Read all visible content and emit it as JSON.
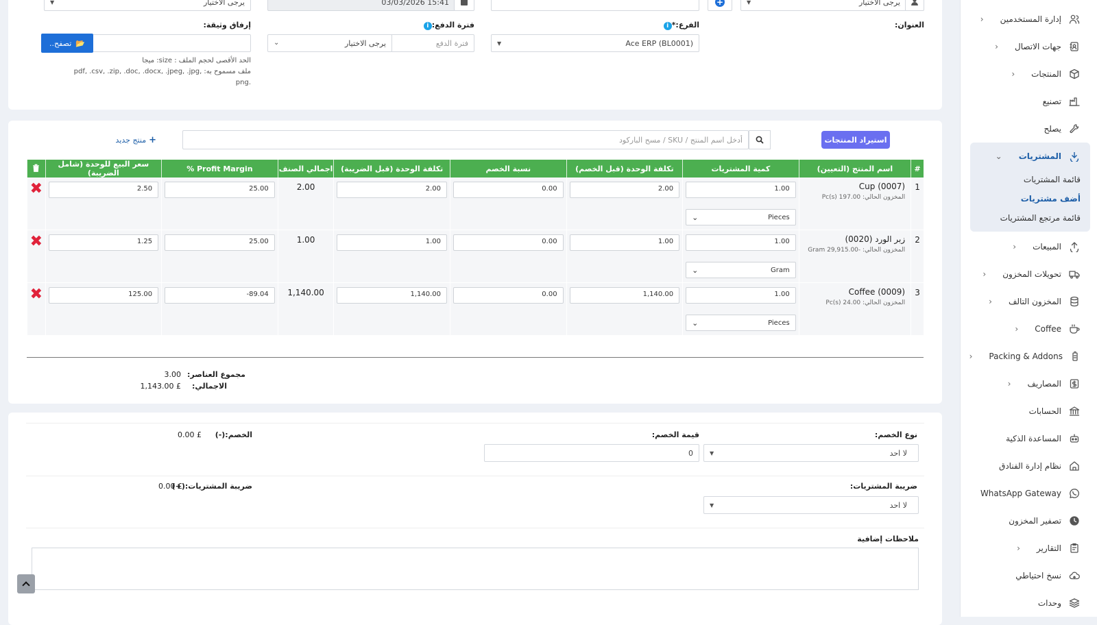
{
  "sidebar": {
    "items": [
      {
        "label": "إدارة المستخدمين",
        "icon": "users-icon",
        "chev": true
      },
      {
        "label": "جهات الاتصال",
        "icon": "contacts-icon",
        "chev": true
      },
      {
        "label": "المنتجات",
        "icon": "box-icon",
        "chev": true
      },
      {
        "label": "تصنيع",
        "icon": "factory-icon",
        "chev": false
      },
      {
        "label": "يصلح",
        "icon": "wrench-icon",
        "chev": false
      }
    ],
    "purchases": {
      "label": "المشتريات",
      "sub": [
        "قائمة المشتريات",
        "أضف مشتريات",
        "قائمة مرتجع المشتريات"
      ]
    },
    "items2": [
      {
        "label": "المبيعات",
        "icon": "upload-icon",
        "chev": true
      },
      {
        "label": "تحويلات المخزون",
        "icon": "truck-icon",
        "chev": true
      },
      {
        "label": "المخزون التالف",
        "icon": "database-icon",
        "chev": true
      },
      {
        "label": "Coffee",
        "icon": "coffee-icon",
        "chev": true
      },
      {
        "label": "Packing & Addons",
        "icon": "battery-icon",
        "chev": true
      },
      {
        "label": "المصاريف",
        "icon": "dollar-icon",
        "chev": true
      },
      {
        "label": "الحسابات",
        "icon": "bank-icon",
        "chev": false
      },
      {
        "label": "المساعدة الذكية",
        "icon": "robot-icon",
        "chev": false
      },
      {
        "label": "نظام إدارة الفنادق",
        "icon": "hotel-icon",
        "chev": false
      },
      {
        "label": "WhatsApp Gateway",
        "icon": "whatsapp-icon",
        "chev": false
      },
      {
        "label": "تصفير المخزون",
        "icon": "clock-icon",
        "chev": false
      },
      {
        "label": "التقارير",
        "icon": "report-icon",
        "chev": true
      },
      {
        "label": "نسخ احتياطي",
        "icon": "cloud-icon",
        "chev": false
      },
      {
        "label": "وحدات",
        "icon": "layers-icon",
        "chev": false
      }
    ]
  },
  "top": {
    "supplier_placeholder": "يرجى الاختيار",
    "datetime": "15:41 03/03/2026",
    "status_placeholder": "يرجى الاختيار",
    "address_label": "العنوان:",
    "branch_label": "الفرع:*",
    "branch_value": "Ace ERP (BL0001)",
    "pay_term_label": "فترة الدفع:",
    "pay_term_placeholder": "فترة الدفع",
    "pay_term_select": "يرجى الاختيار",
    "attach_label": "إرفاق وثيقة:",
    "browse_label": "تصفح..",
    "max_size": "الحد الأقصى لحجم الملف : size: ميجا",
    "allowed": "ملف مسموح به: ,pdf, .csv, .zip, .doc, .docx, .jpeg, .jpg",
    "allowed2": ".png"
  },
  "products": {
    "import_label": "استيراد المنتجات",
    "search_placeholder": "أدخل اسم المنتج / SKU / مسح الباركود",
    "new_product_label": "منتج جديد",
    "headers": [
      "#",
      "اسم المنتج (التعيين)",
      "كمية المشتريات",
      "تكلفة الوحدة (قبل الخصم)",
      "نسبة الخصم",
      "تكلفة الوحدة (قبل الضريبة)",
      "اجمالي الصنف",
      "Profit Margin %",
      "سعر البيع للوحدة (شامل الضريبة)"
    ],
    "rows": [
      {
        "num": "1",
        "name": "Cup (0007)",
        "stock": "المخزون الحالي: 197.00 Pc(s)",
        "qty": "1.00",
        "unit": "Pieces",
        "cost": "2.00",
        "disc": "0.00",
        "cost_tax": "2.00",
        "total": "2.00",
        "margin": "25.00",
        "sell": "2.50"
      },
      {
        "num": "2",
        "name": "زبر الورد (0020)",
        "stock": "المخزون الحالي: -29,915.00 Gram",
        "qty": "1.00",
        "unit": "Gram",
        "cost": "1.00",
        "disc": "0.00",
        "cost_tax": "1.00",
        "total": "1.00",
        "margin": "25.00",
        "sell": "1.25"
      },
      {
        "num": "3",
        "name": "Coffee (0009)",
        "stock": "المخزون الحالي: 24.00 Pc(s)",
        "qty": "1.00",
        "unit": "Pieces",
        "cost": "1,140.00",
        "disc": "0.00",
        "cost_tax": "1,140.00",
        "total": "1,140.00",
        "margin": "-89.04",
        "sell": "125.00"
      }
    ],
    "items_total_label": "مجموع العناصر:",
    "items_total_value": "3.00",
    "net_label": "الاجمالي:",
    "net_value": "1,143.00 £"
  },
  "discount": {
    "type_label": "نوع الخصم:",
    "type_value": "لا احد",
    "amount_label": "قيمة الخصم:",
    "amount_value": "0",
    "result_label": "الخصم:(-)",
    "result_value": "£ 0.00",
    "tax_label": "ضريبة المشتريات:",
    "tax_value": "لا احد",
    "tax_result_label": "ضريبة المشتريات:(+)",
    "tax_result_value": "£ 0.00",
    "notes_label": "ملاحظات إضافية"
  },
  "colors": {
    "green": "#4caf50",
    "accent": "#1e5fa8",
    "purple": "#6a6ff0",
    "danger": "#e0223a"
  }
}
